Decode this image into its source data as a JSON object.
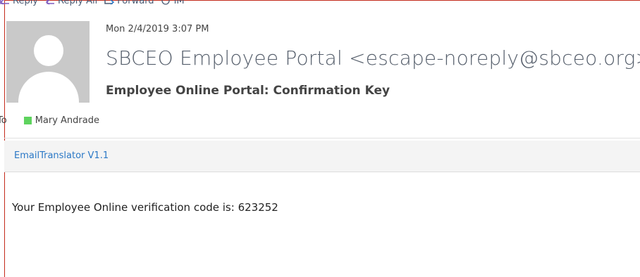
{
  "toolbar": {
    "reply_label": "Reply",
    "reply_all_label": "Reply All",
    "forward_label": "Forward",
    "im_label": "IM",
    "icon_color": "#7d5bbf"
  },
  "message": {
    "date": "Mon 2/4/2019 3:07 PM",
    "sender": "SBCEO Employee Portal <escape-noreply@sbceo.org>",
    "subject": "Employee Online Portal: Confirmation Key",
    "to_label": "To",
    "recipient": "Mary Andrade",
    "recipient_presence_color": "#5ed35e"
  },
  "addin": {
    "name": "EmailTranslator V1.1"
  },
  "body": {
    "text": "Your Employee Online verification code is: 623252"
  },
  "colors": {
    "accent_link": "#2b78c6",
    "frame_red": "#c42b1c"
  }
}
